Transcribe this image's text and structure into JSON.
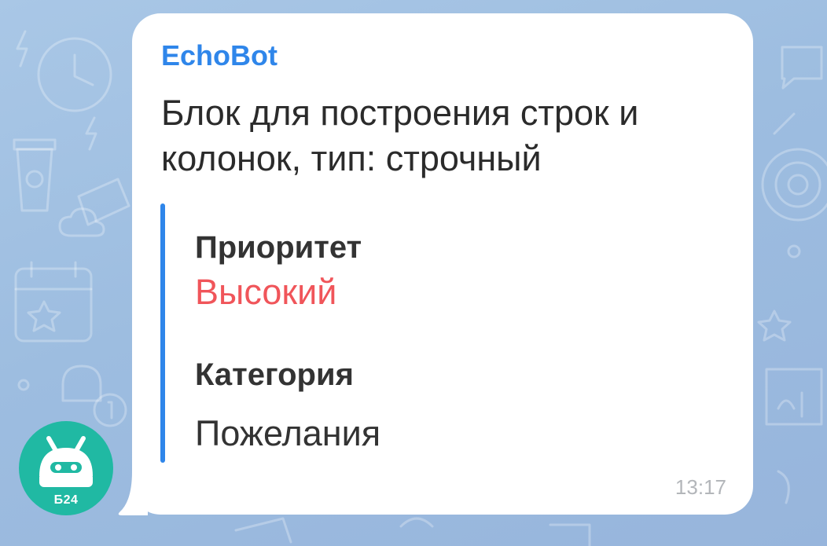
{
  "message": {
    "sender": "EchoBot",
    "text": "Блок для построения строк и колонок, тип: строчный",
    "time": "13:17",
    "fields": [
      {
        "title": "Приоритет",
        "value": "Высокий",
        "value_color": "#f0555a"
      },
      {
        "title": "Категория",
        "value": "Пожелания",
        "value_color": "#333333"
      }
    ]
  },
  "avatar": {
    "label": "Б24",
    "icon": "robot-icon",
    "color": "#20b9a3"
  },
  "colors": {
    "accent": "#2f86ea",
    "bubble": "#ffffff",
    "text": "#2b2b2b",
    "timestamp": "#b3b6ba"
  }
}
